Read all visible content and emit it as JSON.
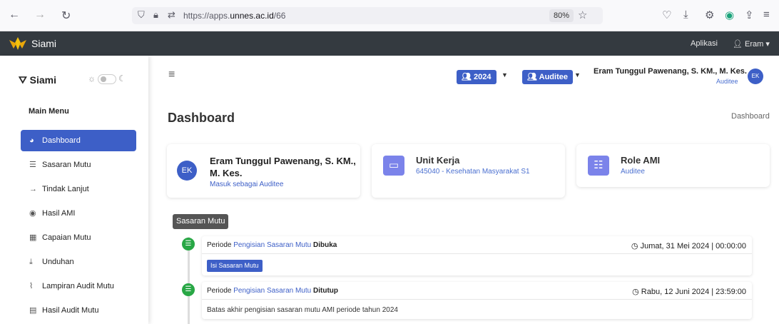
{
  "browser": {
    "url_prefix": "https://apps.",
    "url_domain": "unnes.ac.id",
    "url_path": "/66",
    "zoom": "80%"
  },
  "topnav": {
    "brand": "Siami",
    "aplikasi": "Aplikasi",
    "user": "Eram"
  },
  "sidebar": {
    "brand": "Siami",
    "menu_header": "Main Menu",
    "items": [
      {
        "label": "Dashboard",
        "icon": "dashboard-icon"
      },
      {
        "label": "Sasaran Mutu",
        "icon": "list-icon"
      },
      {
        "label": "Tindak Lanjut",
        "icon": "arrow-right-icon"
      },
      {
        "label": "Hasil AMI",
        "icon": "compass-icon"
      },
      {
        "label": "Capaian Mutu",
        "icon": "table-icon"
      },
      {
        "label": "Unduhan",
        "icon": "download-icon"
      },
      {
        "label": "Lampiran Audit Mutu",
        "icon": "paperclip-icon"
      },
      {
        "label": "Hasil Audit Mutu",
        "icon": "chart-icon"
      }
    ]
  },
  "header": {
    "year": "2024",
    "role": "Auditee",
    "user_name": "Eram Tunggul Pawenang, S. KM., M. Kes.",
    "user_role": "Auditee",
    "avatar": "EK"
  },
  "page": {
    "title": "Dashboard",
    "breadcrumb": "Dashboard"
  },
  "cards": {
    "profile": {
      "avatar": "EK",
      "name": "Eram Tunggul Pawenang, S. KM., M. Kes.",
      "sub": "Masuk sebagai Auditee"
    },
    "unit": {
      "title": "Unit Kerja",
      "value": "645040 - Kesehatan Masyarakat S1"
    },
    "role": {
      "title": "Role AMI",
      "value": "Auditee"
    }
  },
  "timeline": {
    "label": "Sasaran Mutu",
    "items": [
      {
        "prefix": "Periode",
        "highlight": "Pengisian Sasaran Mutu",
        "status": "Dibuka",
        "time": "Jumat, 31 Mei 2024 | 00:00:00",
        "button": "Isi Sasaran Mutu"
      },
      {
        "prefix": "Periode",
        "highlight": "Pengisian Sasaran Mutu",
        "status": "Ditutup",
        "time": "Rabu, 12 Juni 2024 | 23:59:00",
        "body": "Batas akhir pengisian sasaran mutu AMI periode tahun 2024"
      }
    ]
  },
  "colors": {
    "primary": "#3d5fc7",
    "topnav": "#343a40",
    "success": "#28a745",
    "card_icon": "#7b83ea"
  }
}
